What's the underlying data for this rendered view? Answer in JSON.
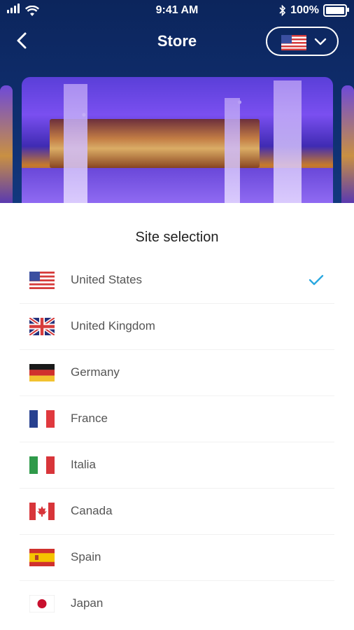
{
  "status_bar": {
    "time": "9:41 AM",
    "battery": "100%",
    "battery_level": 1.0,
    "icons": [
      "signal-icon",
      "wifi-icon",
      "bluetooth-icon",
      "battery-icon"
    ]
  },
  "header": {
    "title": "Store",
    "back_icon": "chevron-left-icon",
    "selected_flag": "flag-us",
    "dropdown_icon": "chevron-down-icon"
  },
  "sheet": {
    "title": "Site selection",
    "accent_color": "#2ba8e0",
    "sites": [
      {
        "name": "United States",
        "flag": "flag-us",
        "selected": true
      },
      {
        "name": "United Kingdom",
        "flag": "flag-uk",
        "selected": false
      },
      {
        "name": "Germany",
        "flag": "flag-de",
        "selected": false
      },
      {
        "name": "France",
        "flag": "flag-fr",
        "selected": false
      },
      {
        "name": "Italia",
        "flag": "flag-it",
        "selected": false
      },
      {
        "name": "Canada",
        "flag": "flag-ca",
        "selected": false
      },
      {
        "name": "Spain",
        "flag": "flag-es",
        "selected": false
      },
      {
        "name": "Japan",
        "flag": "flag-jp",
        "selected": false
      }
    ]
  }
}
